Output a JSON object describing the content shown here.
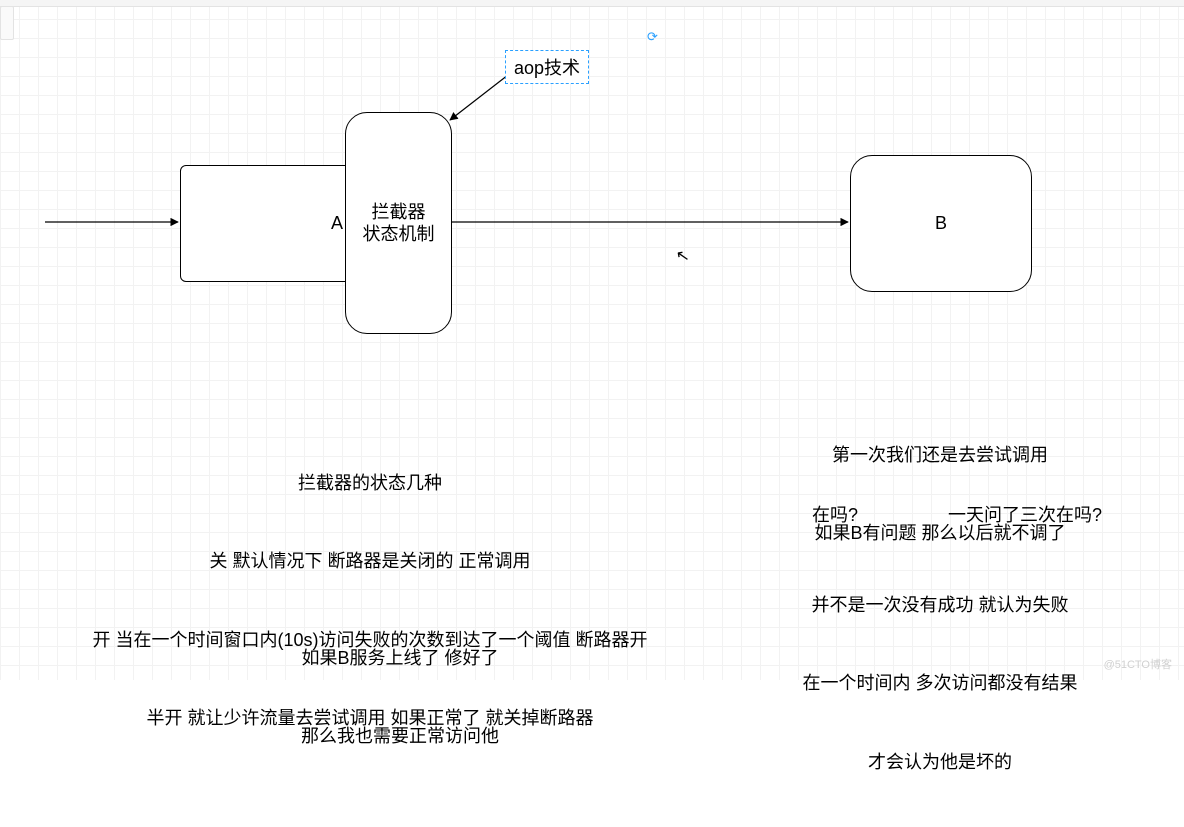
{
  "labels": {
    "aop": "aop技术",
    "nodeA": "A",
    "interceptor": "拦截器\n状态机制",
    "nodeB": "B"
  },
  "textLeft": {
    "l1": "拦截器的状态几种",
    "l2": "关 默认情况下 断路器是关闭的 正常调用",
    "l3": "开 当在一个时间窗口内(10s)访问失败的次数到达了一个阈值 断路器开",
    "l4": "半开 就让少许流量去尝试调用 如果正常了 就关掉断路器"
  },
  "textBottom": {
    "l1": "如果B服务上线了 修好了",
    "l2": "那么我也需要正常访问他"
  },
  "textRight1": {
    "l1": "第一次我们还是去尝试调用",
    "l2": "如果B有问题 那么以后就不调了"
  },
  "textRight2": {
    "a": "在吗?",
    "b": "一天问了三次在吗?"
  },
  "textRight3": {
    "l1": "并不是一次没有成功 就认为失败",
    "l2": "在一个时间内 多次访问都没有结果",
    "l3": "才会认为他是坏的"
  },
  "watermark": "@51CTO博客"
}
